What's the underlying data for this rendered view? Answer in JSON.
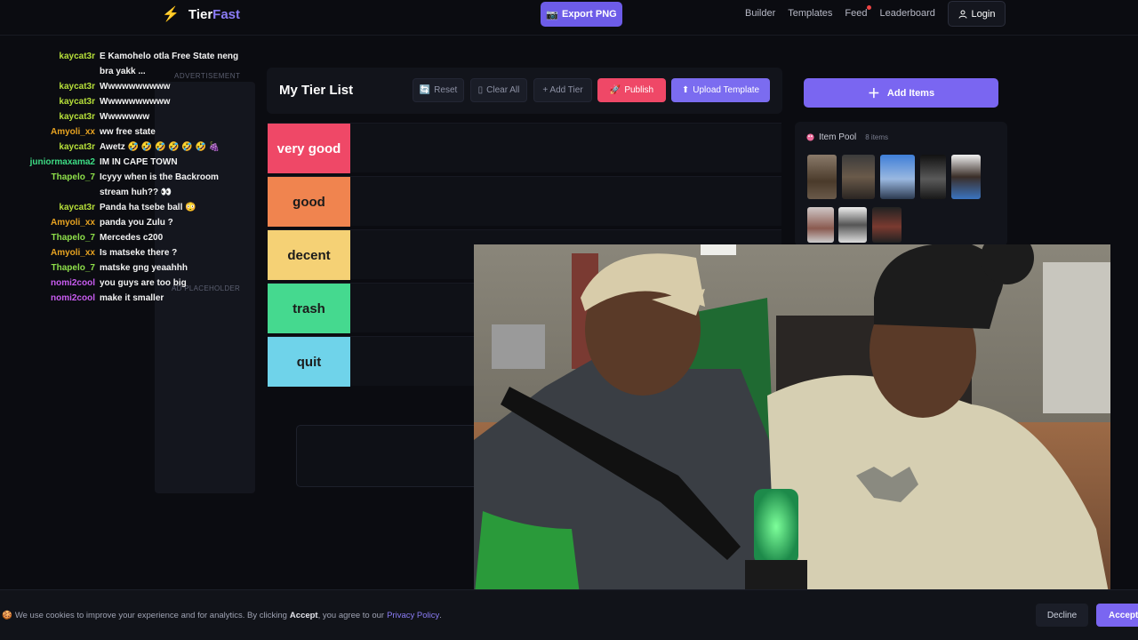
{
  "nav": {
    "logo_tier": "Tier",
    "logo_fast": "Fast",
    "export_label": "Export PNG",
    "links": [
      "Builder",
      "Templates",
      "Feed",
      "Leaderboard"
    ],
    "login_label": "Login"
  },
  "chat": [
    {
      "user": "kaycat3r",
      "color": "#b7e03a",
      "text": "E Kamohelo otla Free State neng bra yakk ..."
    },
    {
      "user": "kaycat3r",
      "color": "#b7e03a",
      "text": "Wwwwwwwwww"
    },
    {
      "user": "kaycat3r",
      "color": "#b7e03a",
      "text": "Wwwwwwwwww"
    },
    {
      "user": "kaycat3r",
      "color": "#b7e03a",
      "text": "Wwwwwww"
    },
    {
      "user": "Amyoli_xx",
      "color": "#e8a321",
      "text": "ww free state"
    },
    {
      "user": "kaycat3r",
      "color": "#b7e03a",
      "text": "Awetz 🤣 🤣 🤣 🤣 🤣 🤣 🍇"
    },
    {
      "user": "juniormaxama2",
      "color": "#3ddc84",
      "text": "IM IN CAPE TOWN"
    },
    {
      "user": "Thapelo_7",
      "color": "#8ee04a",
      "text": "Icyyy when is the Backroom stream huh?? 👀"
    },
    {
      "user": "kaycat3r",
      "color": "#b7e03a",
      "text": "Panda ha tsebe ball 😳"
    },
    {
      "user": "Amyoli_xx",
      "color": "#e8a321",
      "text": "panda you Zulu ?"
    },
    {
      "user": "Thapelo_7",
      "color": "#8ee04a",
      "text": "Mercedes c200"
    },
    {
      "user": "Amyoli_xx",
      "color": "#e8a321",
      "text": "Is matseke there ?"
    },
    {
      "user": "Thapelo_7",
      "color": "#8ee04a",
      "text": "matske gng yeaahhh"
    },
    {
      "user": "nomi2cool",
      "color": "#c85cf0",
      "text": "you guys are too big"
    },
    {
      "user": "nomi2cool",
      "color": "#c85cf0",
      "text": "make it smaller"
    }
  ],
  "ad": {
    "label": "ADVERTISEMENT",
    "placeholder": "AD PLACEHOLDER"
  },
  "tierlist": {
    "title": "My Tier List",
    "reset_label": "Reset",
    "clear_label": "Clear All",
    "add_tier_label": "+ Add Tier",
    "publish_label": "Publish",
    "upload_label": "Upload Template",
    "tiers": [
      {
        "label": "very good",
        "color": "#ef4867",
        "text_color": "#ffffff"
      },
      {
        "label": "good",
        "color": "#f0844f",
        "text_color": "#1b1b1b"
      },
      {
        "label": "decent",
        "color": "#f5d175",
        "text_color": "#1b1b1b"
      },
      {
        "label": "trash",
        "color": "#45d98f",
        "text_color": "#1b1b1b"
      },
      {
        "label": "quit",
        "color": "#6fd3ea",
        "text_color": "#1b1b1b"
      }
    ]
  },
  "sidebar": {
    "add_items_label": "Add Items",
    "pool_title": "Item Pool",
    "pool_count": "8 items"
  },
  "cookie": {
    "text_before": "We use cookies to improve your experience and for analytics. By clicking",
    "accept_word": "Accept",
    "text_after": ", you agree to our",
    "policy_link": "Privacy Policy",
    "period": ".",
    "decline_label": "Decline",
    "accept_label": "Accept"
  }
}
